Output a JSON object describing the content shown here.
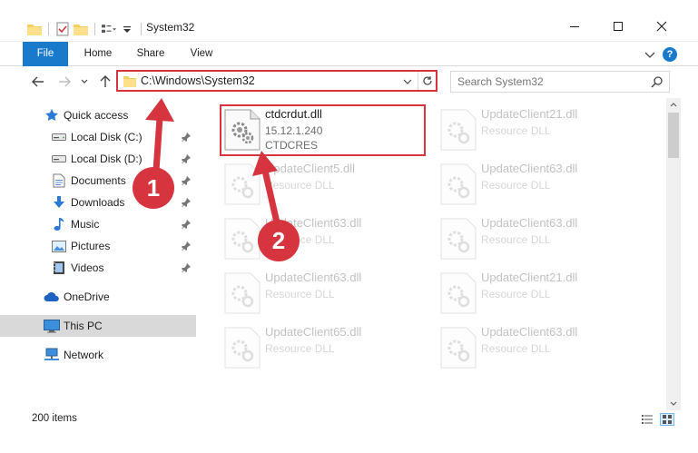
{
  "window": {
    "title": "System32",
    "controls": {
      "minimize": "—",
      "maximize": "☐",
      "close": "✕"
    }
  },
  "ribbon": {
    "tabs": [
      {
        "label": "File"
      },
      {
        "label": "Home"
      },
      {
        "label": "Share"
      },
      {
        "label": "View"
      }
    ],
    "help": "?"
  },
  "address_bar": {
    "path": "C:\\Windows\\System32"
  },
  "search": {
    "placeholder": "Search System32"
  },
  "sidebar": {
    "items": [
      {
        "label": "Quick access",
        "icon": "star-icon",
        "pinned": false
      },
      {
        "label": "Local Disk (C:)",
        "icon": "drive-icon",
        "pinned": true
      },
      {
        "label": "Local Disk (D:)",
        "icon": "drive-icon",
        "pinned": true
      },
      {
        "label": "Documents",
        "icon": "documents-icon",
        "pinned": true
      },
      {
        "label": "Downloads",
        "icon": "download-icon",
        "pinned": true
      },
      {
        "label": "Music",
        "icon": "music-icon",
        "pinned": true
      },
      {
        "label": "Pictures",
        "icon": "pictures-icon",
        "pinned": true
      },
      {
        "label": "Videos",
        "icon": "videos-icon",
        "pinned": true
      },
      {
        "label": "OneDrive",
        "icon": "cloud-icon",
        "pinned": false
      },
      {
        "label": "This PC",
        "icon": "computer-icon",
        "pinned": false,
        "selected": true
      },
      {
        "label": "Network",
        "icon": "network-icon",
        "pinned": false
      }
    ]
  },
  "files": [
    {
      "name": "ctdcrdut.dll",
      "line1": "15.12.1.240",
      "line2": "CTDCRES",
      "highlighted": true
    },
    {
      "name": "UpdateClient21.dll",
      "line1": "Resource DLL"
    },
    {
      "name": "UpdateClient5.dll",
      "line1": "Resource DLL"
    },
    {
      "name": "UpdateClient63.dll",
      "line1": "Resource DLL"
    },
    {
      "name": "UpdateClient63.dll",
      "line1": "Resource DLL"
    },
    {
      "name": "UpdateClient63.dll",
      "line1": "Resource DLL"
    },
    {
      "name": "UpdateClient63.dll",
      "line1": "Resource DLL"
    },
    {
      "name": "UpdateClient21.dll",
      "line1": "Resource DLL"
    },
    {
      "name": "UpdateClient65.dll",
      "line1": "Resource DLL"
    },
    {
      "name": "UpdateClient63.dll",
      "line1": "Resource DLL"
    }
  ],
  "status": {
    "item_count": "200 items"
  },
  "annotations": {
    "step1": "1",
    "step2": "2",
    "color": "#d6343f"
  },
  "colors": {
    "accent": "#1979ca",
    "highlight": "#d6343f",
    "selected_nav": "#d9d9d9"
  }
}
